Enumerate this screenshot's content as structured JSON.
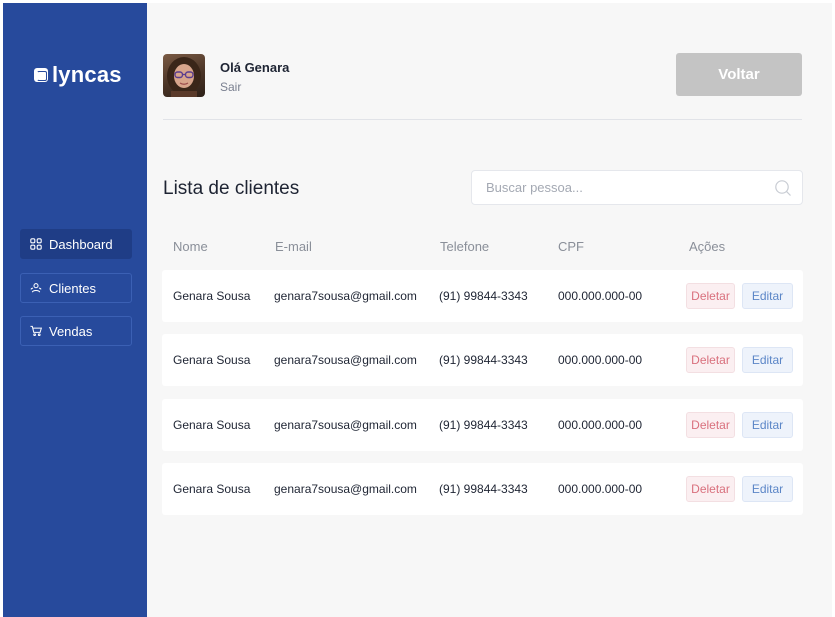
{
  "brand": {
    "name": "lyncas"
  },
  "sidebar": {
    "items": [
      {
        "label": "Dashboard",
        "icon": "grid-icon",
        "active": true
      },
      {
        "label": "Clientes",
        "icon": "users-icon",
        "active": false
      },
      {
        "label": "Vendas",
        "icon": "cart-icon",
        "active": false
      }
    ]
  },
  "header": {
    "greeting": "Olá Genara",
    "logout_label": "Sair",
    "back_label": "Voltar"
  },
  "main": {
    "title": "Lista de clientes",
    "search": {
      "placeholder": "Buscar pessoa..."
    }
  },
  "table": {
    "columns": [
      "Nome",
      "E-mail",
      "Telefone",
      "CPF",
      "Ações"
    ],
    "rows": [
      {
        "name": "Genara Sousa",
        "email": "genara7sousa@gmail.com",
        "phone": "(91) 99844-3343",
        "cpf": "000.000.000-00",
        "delete_label": "Deletar",
        "edit_label": "Editar"
      },
      {
        "name": "Genara Sousa",
        "email": "genara7sousa@gmail.com",
        "phone": "(91) 99844-3343",
        "cpf": "000.000.000-00",
        "delete_label": "Deletar",
        "edit_label": "Editar"
      },
      {
        "name": "Genara Sousa",
        "email": "genara7sousa@gmail.com",
        "phone": "(91) 99844-3343",
        "cpf": "000.000.000-00",
        "delete_label": "Deletar",
        "edit_label": "Editar"
      },
      {
        "name": "Genara Sousa",
        "email": "genara7sousa@gmail.com",
        "phone": "(91) 99844-3343",
        "cpf": "000.000.000-00",
        "delete_label": "Deletar",
        "edit_label": "Editar"
      }
    ]
  },
  "colors": {
    "sidebar": "#274a9c",
    "delete": "#d9707d",
    "edit": "#5b86c7",
    "back_button": "#c4c4c4"
  }
}
